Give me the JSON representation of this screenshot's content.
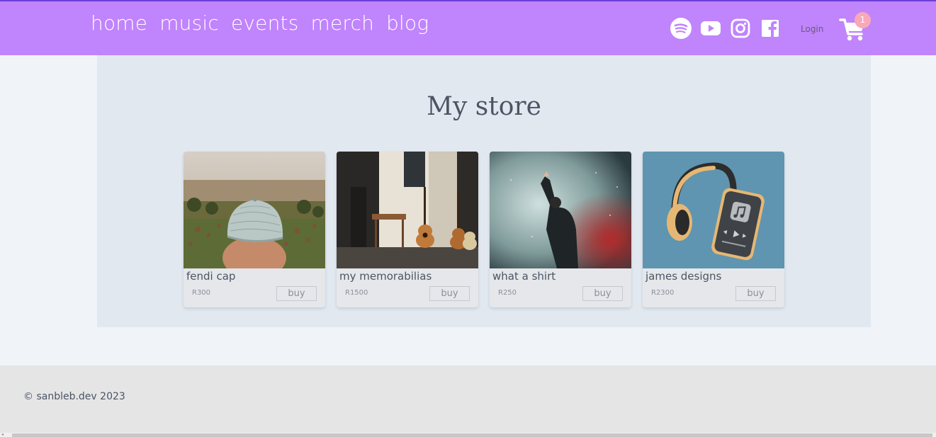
{
  "nav": {
    "links": [
      {
        "label": "home"
      },
      {
        "label": "music"
      },
      {
        "label": "events"
      },
      {
        "label": "merch"
      },
      {
        "label": "blog"
      }
    ],
    "social_icons": [
      "spotify-icon",
      "youtube-icon",
      "instagram-icon",
      "facebook-icon"
    ],
    "login_label": "Login",
    "cart_count": "1"
  },
  "store": {
    "title": "My store",
    "products": [
      {
        "name": "fendi cap",
        "price": "R300",
        "buy_label": "buy",
        "image": "cap-crowd-photo"
      },
      {
        "name": "my memorabilias",
        "price": "R1500",
        "buy_label": "buy",
        "image": "guitars-room-photo"
      },
      {
        "name": "what a shirt",
        "price": "R250",
        "buy_label": "buy",
        "image": "concert-smoke-photo"
      },
      {
        "name": "james designs",
        "price": "R2300",
        "buy_label": "buy",
        "image": "headphones-phone-illustration"
      }
    ]
  },
  "footer": {
    "copyright": "© sanbleb.dev 2023"
  },
  "colors": {
    "navbar": "#c084fc",
    "page_bg": "#f0f3f7",
    "main_bg": "#e2e8f0",
    "card_bg": "#e5e7eb",
    "footer_bg": "#e5e5e5",
    "badge": "#f9a8b8"
  }
}
